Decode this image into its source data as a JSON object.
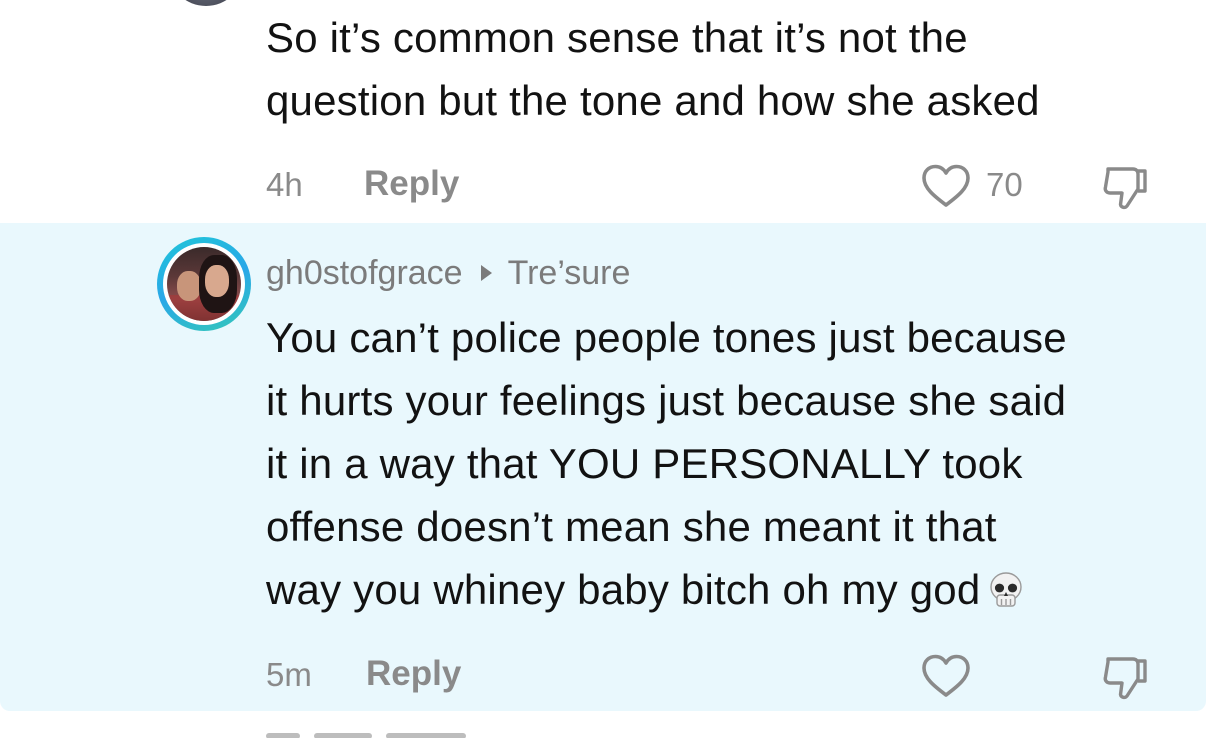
{
  "comments": [
    {
      "text": "So it’s common sense that it’s not the\nquestion but the tone and how she asked",
      "time": "4h",
      "reply_label": "Reply",
      "like_count": "70"
    },
    {
      "username": "gh0stofgrace",
      "reply_to": "Tre’sure",
      "text": "You can’t police people tones just because\nit hurts your feelings just because she said\nit in a way that YOU PERSONALLY took\noffense doesn’t mean she meant it that\nway you whiney baby bitch oh my god",
      "emoji": "skull",
      "time": "5m",
      "reply_label": "Reply",
      "highlighted": true
    }
  ],
  "colors": {
    "highlight_bg": "#e9f8fd",
    "meta_gray": "#8a8a8a",
    "avatar_ring": "#2aa7e8"
  },
  "icons": {
    "like": "heart-outline-icon",
    "dislike": "thumbs-down-icon",
    "reply_arrow": "caret-right-icon",
    "emoji": "skull-icon"
  }
}
